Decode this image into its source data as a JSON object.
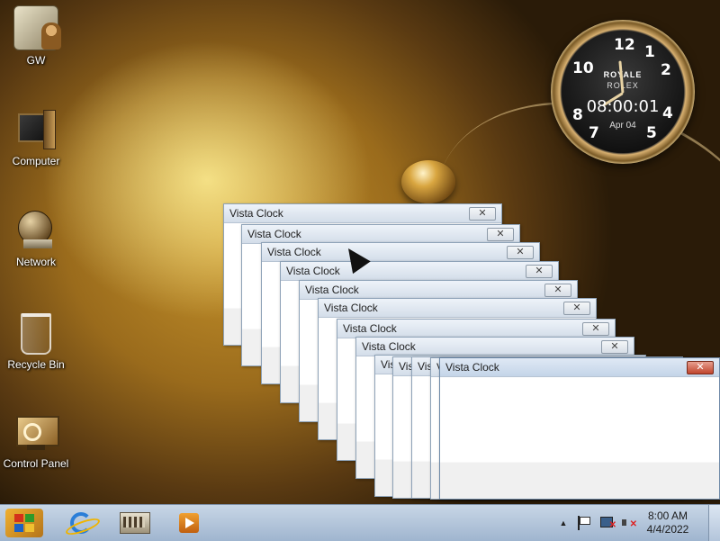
{
  "desktop": {
    "icons": [
      {
        "label": "GW",
        "icon": "gw-app-icon"
      },
      {
        "label": "Computer",
        "icon": "computer-icon"
      },
      {
        "label": "Network",
        "icon": "network-icon"
      },
      {
        "label": "Recycle Bin",
        "icon": "recycle-bin-icon"
      },
      {
        "label": "Control Panel",
        "icon": "control-panel-icon"
      }
    ]
  },
  "clock_gadget": {
    "brand_line1": "ROYALE",
    "brand_line2": "ROLEX",
    "digital_time": "08:00:01",
    "date": "Apr 04",
    "numerals": [
      "12",
      "1",
      "2",
      "10",
      "4",
      "5",
      "8",
      "7"
    ]
  },
  "windows": {
    "title": "Vista Clock",
    "close_glyph": "✕",
    "count": 13
  },
  "taskbar": {
    "pinned": [
      {
        "name": "internet-explorer",
        "icon": "ie-icon"
      },
      {
        "name": "file-explorer",
        "icon": "folder-icon"
      },
      {
        "name": "media-player",
        "icon": "media-player-icon"
      }
    ],
    "tray_time": "8:00 AM",
    "tray_date": "4/4/2022",
    "tray_up_arrow": "▲"
  },
  "colors": {
    "taskbar": "#b3c7dd",
    "window_titlebar": "#d3dde9",
    "active_close": "#c0442c"
  }
}
